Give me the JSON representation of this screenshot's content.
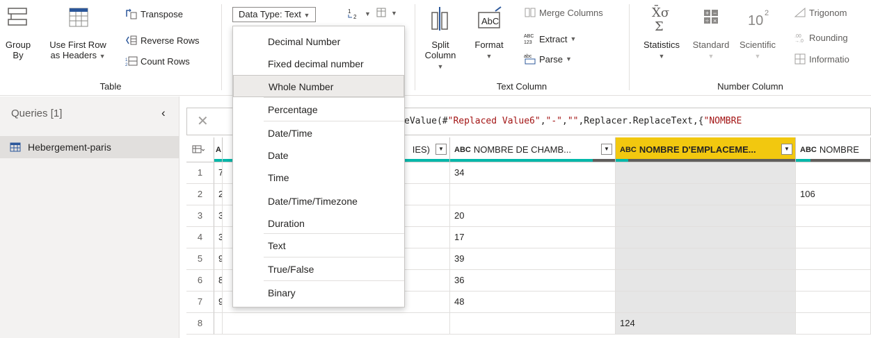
{
  "ribbon": {
    "table_group": {
      "label": "Table",
      "group_by": [
        "Group",
        "By"
      ],
      "use_first_row": [
        "Use First Row",
        "as Headers"
      ],
      "transpose": "Transpose",
      "reverse_rows": "Reverse Rows",
      "count_rows": "Count Rows"
    },
    "data_type_button": "Data Type: Text",
    "text_column_group": {
      "label": "Text Column",
      "split_column": [
        "Split",
        "Column"
      ],
      "format": "Format",
      "merge_columns": "Merge Columns",
      "extract": "Extract",
      "parse": "Parse"
    },
    "number_column_group": {
      "label": "Number Column",
      "statistics": "Statistics",
      "standard": "Standard",
      "scientific": "Scientific",
      "trigonometry": "Trigonom",
      "rounding": "Rounding",
      "information": "Informatio"
    }
  },
  "queries": {
    "title": "Queries [1]",
    "items": [
      {
        "label": "Hebergement-paris"
      }
    ]
  },
  "formula": {
    "prefix": "eValue(#",
    "s1": "\"Replaced Value6\"",
    "comma1": ",",
    "s2": "\"-\"",
    "comma2": ",",
    "s3": "\"\"",
    "rest": ",Replacer.ReplaceText,{",
    "s4": "\"NOMBRE"
  },
  "columns": [
    {
      "type": "A",
      "label": "",
      "partial": true
    },
    {
      "label": "IES)"
    },
    {
      "type": "ABC",
      "label": "NOMBRE DE CHAMB..."
    },
    {
      "type": "ABC",
      "label": "NOMBRE D'EMPLACEME...",
      "selected": true
    },
    {
      "type": "ABC",
      "label": "NOMBRE"
    }
  ],
  "rows": [
    {
      "idx": "1",
      "a": "7",
      "ch": "34",
      "em": "",
      "nb": ""
    },
    {
      "idx": "2",
      "a": "2",
      "ch": "",
      "em": "",
      "nb": "106"
    },
    {
      "idx": "3",
      "a": "3",
      "ch": "20",
      "em": "",
      "nb": ""
    },
    {
      "idx": "4",
      "a": "3",
      "ch": "17",
      "em": "",
      "nb": ""
    },
    {
      "idx": "5",
      "a": "9",
      "ch": "39",
      "em": "",
      "nb": ""
    },
    {
      "idx": "6",
      "a": "8",
      "ch": "36",
      "em": "",
      "nb": ""
    },
    {
      "idx": "7",
      "a": "9",
      "ch": "48",
      "em": "",
      "nb": ""
    },
    {
      "idx": "8",
      "a": "",
      "ch": "",
      "em": "124",
      "nb": ""
    }
  ],
  "data_type_menu": [
    {
      "label": "Decimal Number"
    },
    {
      "label": "Fixed decimal number"
    },
    {
      "label": "Whole Number",
      "highlighted": true
    },
    {
      "label": "Percentage"
    },
    {
      "label": "Date/Time"
    },
    {
      "label": "Date"
    },
    {
      "label": "Time"
    },
    {
      "label": "Date/Time/Timezone"
    },
    {
      "label": "Duration"
    },
    {
      "label": "Text"
    },
    {
      "label": "True/False"
    },
    {
      "label": "Binary"
    }
  ],
  "colors": {
    "selected_header": "#f2c80f",
    "quality_bar": "#01b8aa",
    "selected_column_bg": "#e6e6e6"
  }
}
